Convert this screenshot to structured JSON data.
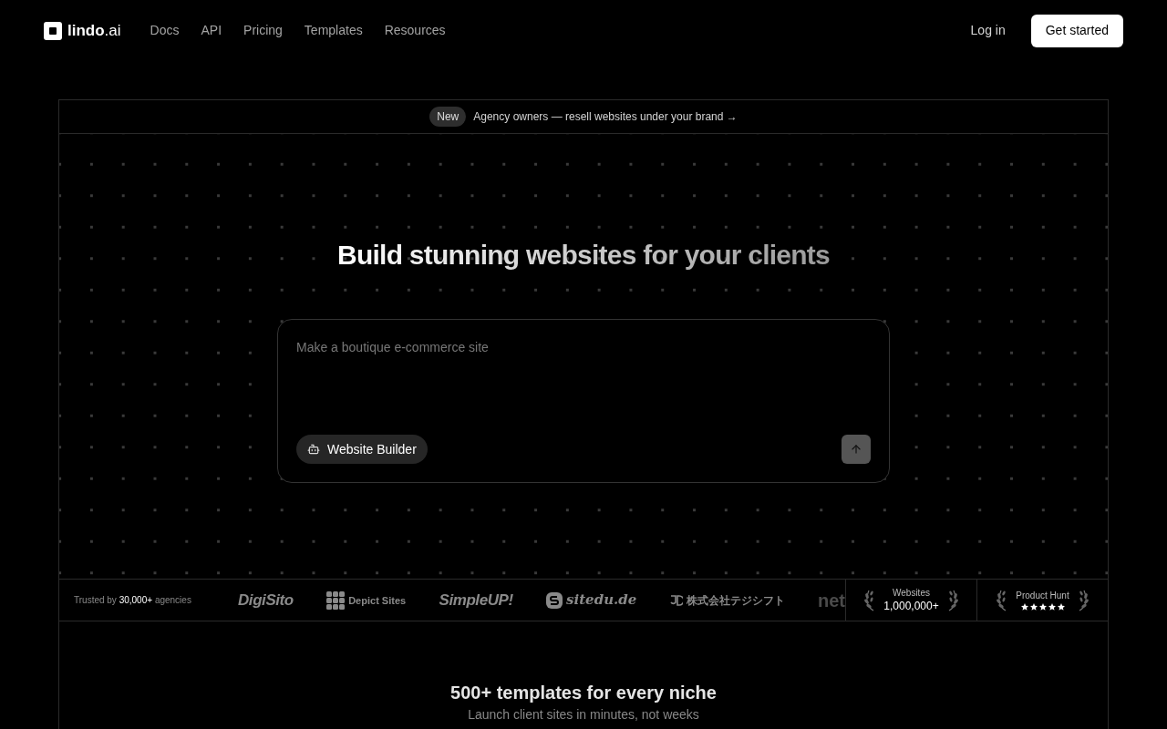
{
  "nav": {
    "logo": {
      "mark_text": "lindo",
      "suffix": ".ai"
    },
    "links": [
      "Docs",
      "API",
      "Pricing",
      "Templates",
      "Resources"
    ],
    "login": "Log in",
    "cta": "Get started"
  },
  "announcement": {
    "badge": "New",
    "text": "Agency owners — resell websites under your brand →"
  },
  "hero": {
    "headline": "Build stunning websites for your clients",
    "prompt": {
      "placeholder": "Make a boutique e-commerce site",
      "mode": "Website Builder"
    }
  },
  "trust": {
    "prefix": "Trusted by",
    "count": "30,000+",
    "suffix": "agencies",
    "logos": [
      {
        "kind": "wordmark",
        "text": "DigiSito"
      },
      {
        "kind": "grid",
        "text": "Depict Sites"
      },
      {
        "kind": "wordmark",
        "text": "SimpleUP!"
      },
      {
        "kind": "badge",
        "text": "sitedu.de"
      },
      {
        "kind": "kanji",
        "text": "株式会社テジシフト"
      },
      {
        "kind": "faded",
        "text": "net"
      }
    ],
    "stats": [
      {
        "kind": "count",
        "label": "Websites",
        "value": "1,000,000+"
      },
      {
        "kind": "rating",
        "label": "Product Hunt",
        "stars": 5
      }
    ]
  },
  "templates": {
    "title": "500+ templates for every niche",
    "subtitle": "Launch client sites in minutes, not weeks"
  }
}
